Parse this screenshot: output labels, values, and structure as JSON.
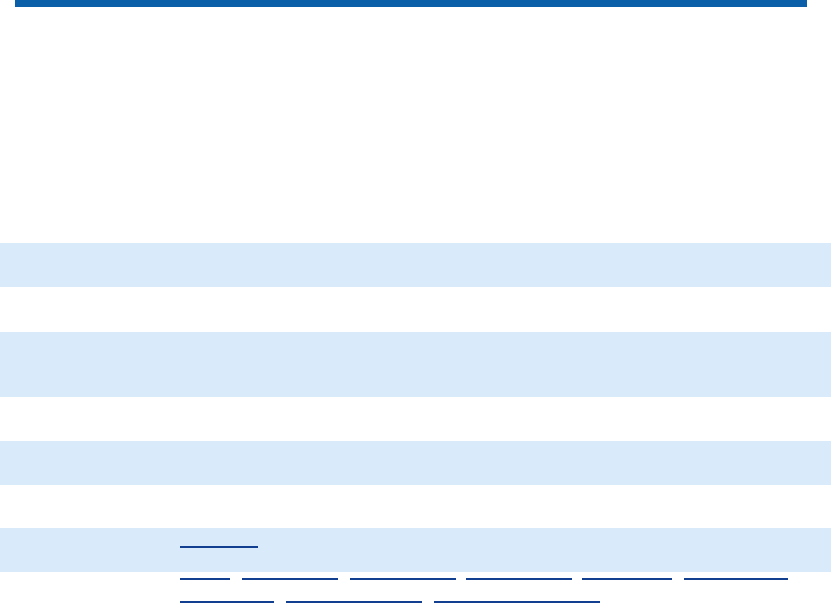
{
  "header": {
    "accent_color": "#0a5fa8"
  },
  "table": {
    "row_color_shaded": "#d9ebfb",
    "row_color_plain": "#ffffff",
    "rows": [
      {
        "label": "",
        "value": ""
      },
      {
        "label": "",
        "value": ""
      },
      {
        "label": "",
        "value": ""
      },
      {
        "label": "",
        "value": ""
      },
      {
        "label": "",
        "value": ""
      },
      {
        "label": "",
        "value": ""
      },
      {
        "label": "",
        "value": ""
      },
      {
        "label": "",
        "value": ""
      }
    ]
  },
  "links": {
    "single": [
      {
        "text": ""
      }
    ],
    "multi_line_1": [
      {
        "text": ""
      },
      {
        "text": ""
      },
      {
        "text": ""
      },
      {
        "text": ""
      },
      {
        "text": ""
      },
      {
        "text": ""
      }
    ],
    "multi_line_2": [
      {
        "text": ""
      },
      {
        "text": ""
      },
      {
        "text": ""
      }
    ]
  }
}
